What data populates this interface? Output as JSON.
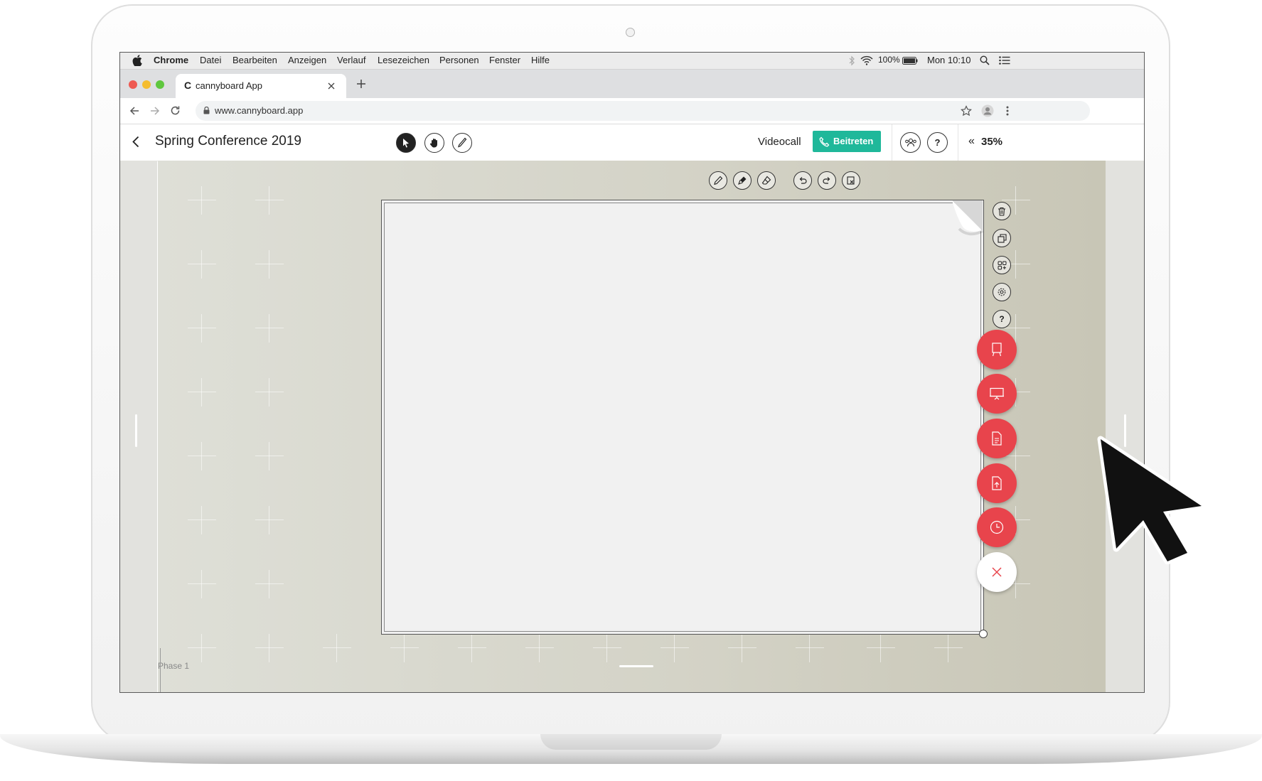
{
  "menubar": {
    "app": "Chrome",
    "items": [
      "Datei",
      "Bearbeiten",
      "Anzeigen",
      "Verlauf",
      "Lesezeichen",
      "Personen",
      "Fenster",
      "Hilfe"
    ],
    "battery": "100%",
    "clock": "Mon 10:10"
  },
  "browser": {
    "tab_title": "cannyboard App",
    "tab_favicon": "C",
    "url": "www.cannyboard.app"
  },
  "app": {
    "title": "Spring Conference 2019",
    "videocall_label": "Videocall",
    "join_label": "Beitreten",
    "help_label": "?",
    "zoom": "35%",
    "zoom_chevron": "«"
  },
  "board": {
    "phase_label": "Phase 1",
    "side_help": "?"
  },
  "colors": {
    "accent_join": "#1fb89a",
    "fab_red": "#e8444c"
  }
}
